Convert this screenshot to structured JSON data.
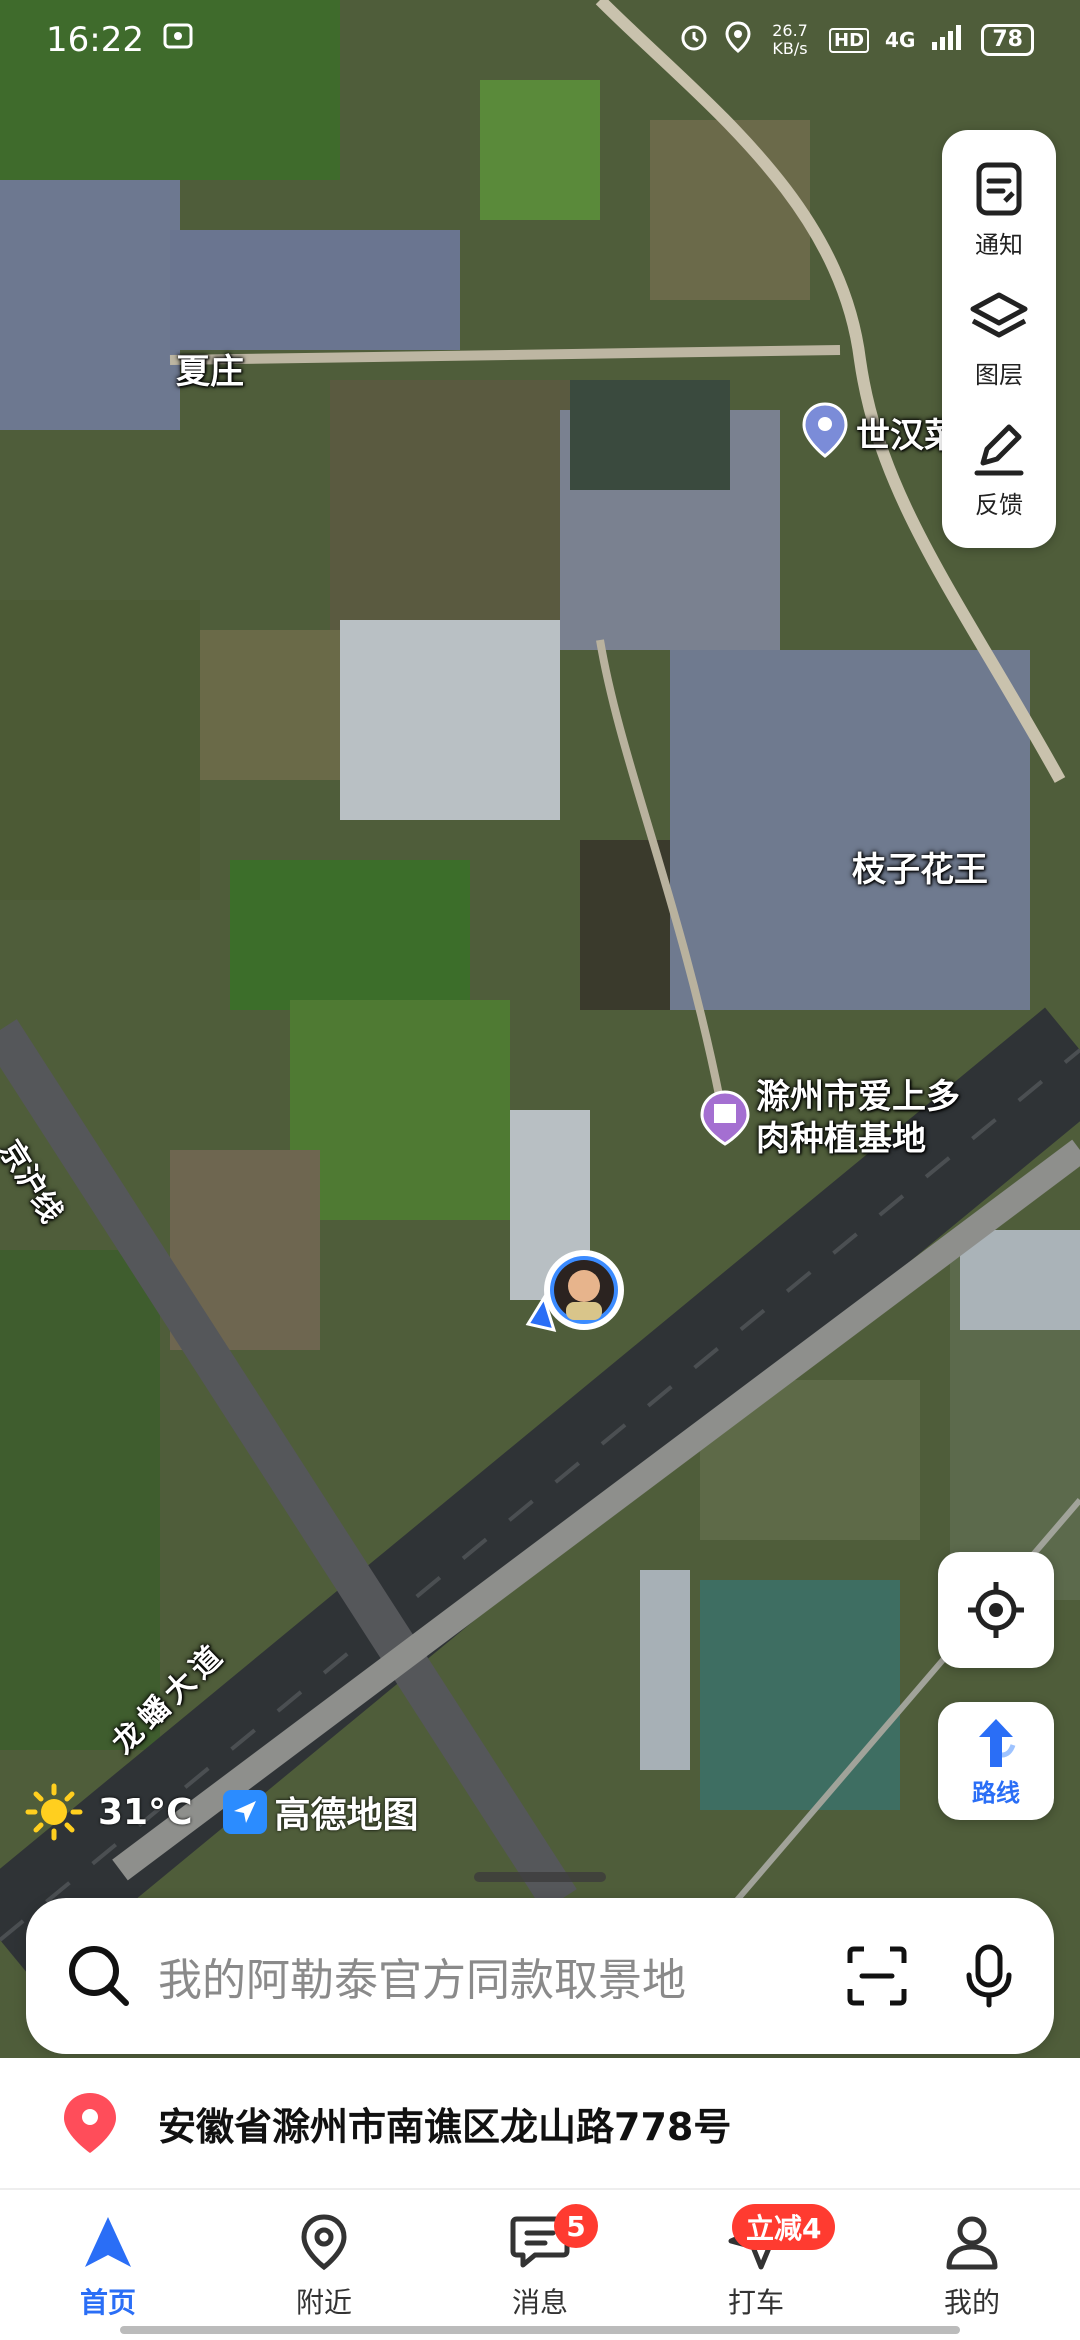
{
  "status_bar": {
    "time": "16:22",
    "net_speed": "26.7 KB/s",
    "hd": "HD",
    "signal": "4G",
    "battery": "78"
  },
  "tools": [
    {
      "label": "通知",
      "icon": "notification-icon"
    },
    {
      "label": "图层",
      "icon": "layers-icon"
    },
    {
      "label": "反馈",
      "icon": "feedback-icon"
    }
  ],
  "map": {
    "places": {
      "xiazhuang": "夏庄",
      "shihan": "世汉菜场",
      "zhizi": "枝子花王",
      "base_line1": "滁州市爱上多",
      "base_line2": "肉种植基地"
    },
    "roads": {
      "jinghu": "京沪线",
      "longfan": "龙蟠大道"
    }
  },
  "route_button": {
    "label": "路线"
  },
  "weather": {
    "temp": "31°C",
    "logo_text": "高德地图"
  },
  "search": {
    "placeholder": "我的阿勒泰官方同款取景地"
  },
  "location": {
    "address": "安徽省滁州市南谯区龙山路778号"
  },
  "tabbar": {
    "items": [
      {
        "label": "首页",
        "icon": "home-arrow-icon"
      },
      {
        "label": "附近",
        "icon": "pin-icon"
      },
      {
        "label": "消息",
        "icon": "message-icon",
        "badge": "5"
      },
      {
        "label": "打车",
        "icon": "taxi-icon",
        "badge": "立减4"
      },
      {
        "label": "我的",
        "icon": "person-icon"
      }
    ]
  },
  "colors": {
    "accent": "#2a6ef6",
    "badge": "#ff3b30"
  }
}
